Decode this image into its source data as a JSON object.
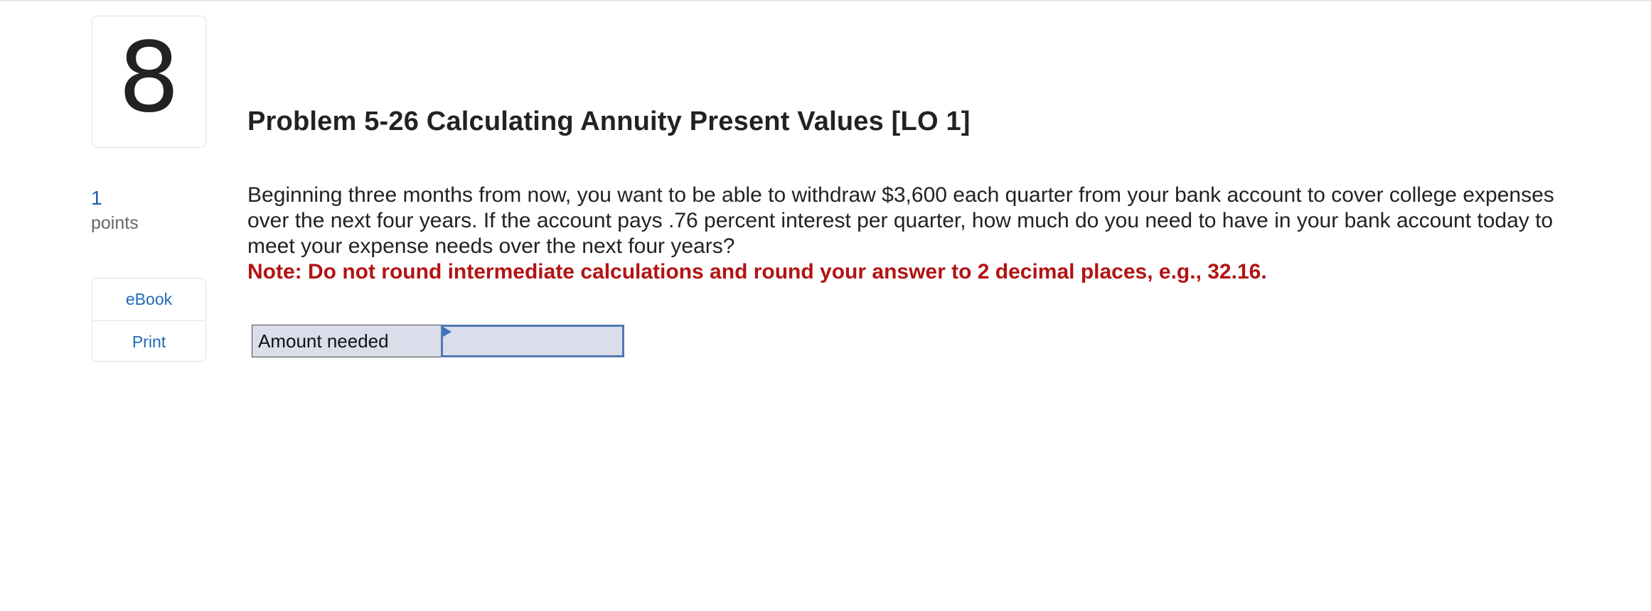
{
  "question": {
    "number": "8",
    "title": "Problem 5-26 Calculating Annuity Present Values [LO 1]",
    "points_value": "1",
    "points_label": "points",
    "body": "Beginning three months from now, you want to be able to withdraw $3,600 each quarter from your bank account to cover college expenses over the next four years. If the account pays .76 percent interest per quarter, how much do you need to have in your bank account today to meet your expense needs over the next four years?",
    "note": "Note: Do not round intermediate calculations and round your answer to 2 decimal places, e.g., 32.16."
  },
  "tools": {
    "ebook_label": "eBook",
    "print_label": "Print"
  },
  "answer": {
    "label": "Amount needed",
    "value": ""
  },
  "colors": {
    "note_red": "#b31313",
    "link_blue": "#1f6bb5",
    "cell_fill": "#dadeea",
    "cell_border_active": "#5078b4"
  }
}
